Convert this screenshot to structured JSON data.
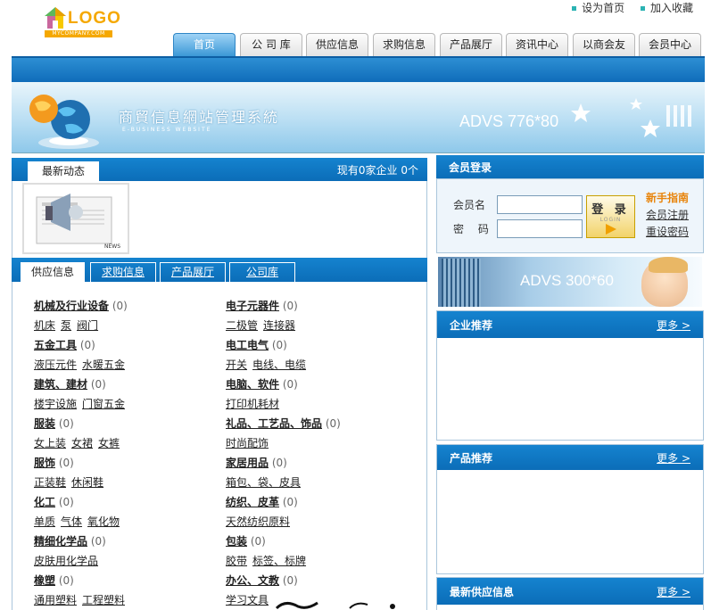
{
  "logo": {
    "text": "LOGO",
    "sub": "MYCOMPANY.COM"
  },
  "top_links": [
    "设为首页",
    "加入收藏"
  ],
  "nav": [
    "首页",
    "公 司 库",
    "供应信息",
    "求购信息",
    "产品展厅",
    "资讯中心",
    "以商会友",
    "会员中心"
  ],
  "banner": {
    "title": "商貿信息網站管理系統",
    "subtitle": "E-BUSINESS WEBSITE",
    "adv": "ADVS 776*80"
  },
  "news": {
    "tab": "最新动态",
    "right": "现有0家企业  0个",
    "image_label": "NEWS"
  },
  "subtabs": [
    "供应信息",
    "求购信息",
    "产品展厅",
    "公司库"
  ],
  "categories_left": [
    {
      "name": "机械及行业设备",
      "count": "(0)",
      "subs": [
        "机床",
        "泵",
        "阀门"
      ]
    },
    {
      "name": "五金工具",
      "count": "(0)",
      "subs": [
        "液压元件",
        "水暖五金"
      ]
    },
    {
      "name": "建筑、建材",
      "count": "(0)",
      "subs": [
        "楼宇设施",
        "门窗五金"
      ]
    },
    {
      "name": "服装",
      "count": "(0)",
      "subs": [
        "女上装",
        "女裙",
        "女裤"
      ]
    },
    {
      "name": "服饰",
      "count": "(0)",
      "subs": [
        "正装鞋",
        "休闲鞋"
      ]
    },
    {
      "name": "化工",
      "count": "(0)",
      "subs": [
        "单质",
        "气体",
        "氧化物"
      ]
    },
    {
      "name": "精细化学品",
      "count": "(0)",
      "subs": [
        "皮肤用化学品"
      ]
    },
    {
      "name": "橡塑",
      "count": "(0)",
      "subs": [
        "通用塑料",
        "工程塑料"
      ]
    }
  ],
  "categories_right": [
    {
      "name": "电子元器件",
      "count": "(0)",
      "subs": [
        "二极管",
        "连接器"
      ]
    },
    {
      "name": "电工电气",
      "count": "(0)",
      "subs": [
        "开关",
        "电线、电缆"
      ]
    },
    {
      "name": "电脑、软件",
      "count": "(0)",
      "subs": [
        "打印机耗材"
      ]
    },
    {
      "name": "礼品、工艺品、饰品",
      "count": "(0)",
      "subs": [
        "时尚配饰"
      ]
    },
    {
      "name": "家居用品",
      "count": "(0)",
      "subs": [
        "箱包、袋、皮具"
      ]
    },
    {
      "name": "纺织、皮革",
      "count": "(0)",
      "subs": [
        "天然纺织原料"
      ]
    },
    {
      "name": "包装",
      "count": "(0)",
      "subs": [
        "胶带",
        "标签、标牌"
      ]
    },
    {
      "name": "办公、文教",
      "count": "(0)",
      "subs": [
        "学习文具"
      ]
    }
  ],
  "login": {
    "title": "会员登录",
    "username_label": "会员名",
    "password_label": "密  码",
    "button": "登 录",
    "button_sub": "LOGIN",
    "guide": "新手指南",
    "register": "会员注册",
    "reset": "重设密码"
  },
  "adv300": "ADVS 300*60",
  "side_boxes": [
    {
      "title": "企业推荐",
      "more": "更多 >"
    },
    {
      "title": "产品推荐",
      "more": "更多 >"
    },
    {
      "title": "最新供应信息",
      "more": "更多 >"
    }
  ],
  "colors": {
    "primary_blue": "#1583cf",
    "accent_orange": "#e8840b",
    "logo_gold": "#f5a800"
  }
}
